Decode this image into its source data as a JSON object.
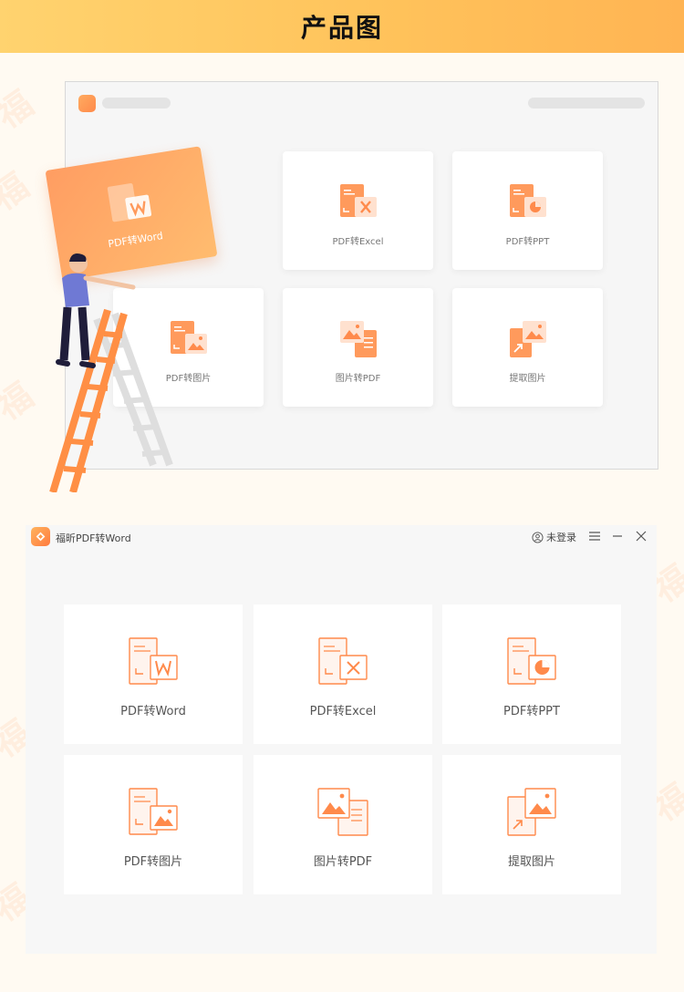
{
  "banner": {
    "title": "产品图"
  },
  "mockup": {
    "held_card_label": "PDF转Word",
    "cards": [
      {
        "label": "PDF转Excel",
        "icon": "pdf-to-excel-icon"
      },
      {
        "label": "PDF转PPT",
        "icon": "pdf-to-ppt-icon"
      },
      {
        "label": "PDF转图片",
        "icon": "pdf-to-image-icon"
      },
      {
        "label": "图片转PDF",
        "icon": "image-to-pdf-icon"
      },
      {
        "label": "提取图片",
        "icon": "extract-image-icon"
      }
    ]
  },
  "app": {
    "title": "福昕PDF转Word",
    "login_label": "未登录",
    "cards": [
      {
        "label": "PDF转Word",
        "icon": "pdf-to-word-icon"
      },
      {
        "label": "PDF转Excel",
        "icon": "pdf-to-excel-icon"
      },
      {
        "label": "PDF转PPT",
        "icon": "pdf-to-ppt-icon"
      },
      {
        "label": "PDF转图片",
        "icon": "pdf-to-image-icon"
      },
      {
        "label": "图片转PDF",
        "icon": "image-to-pdf-icon"
      },
      {
        "label": "提取图片",
        "icon": "extract-image-icon"
      }
    ]
  },
  "colors": {
    "accent": "#ff8a4b",
    "accent_light": "#ffd9c4",
    "banner_start": "#ffd36f",
    "banner_end": "#ffb453"
  }
}
